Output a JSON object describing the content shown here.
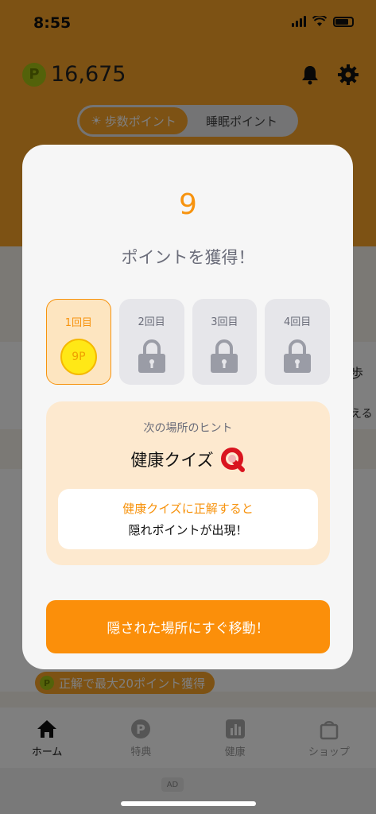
{
  "status_bar": {
    "time": "8:55"
  },
  "header": {
    "points": "16,675",
    "coin_letter": "P"
  },
  "segment": {
    "steps_label": "歩数ポイント",
    "sleep_label": "睡眠ポイント"
  },
  "background": {
    "badge_text": "正解で最大20ポイント獲得",
    "side_text_1": "歩",
    "side_text_2": "える"
  },
  "tabbar": {
    "items": [
      {
        "label": "ホーム",
        "icon": "home-icon"
      },
      {
        "label": "特典",
        "icon": "points-icon"
      },
      {
        "label": "健康",
        "icon": "chart-icon"
      },
      {
        "label": "ショップ",
        "icon": "shop-bag-icon"
      }
    ]
  },
  "ad": {
    "label": "AD"
  },
  "modal": {
    "points_earned": "9",
    "message": "ポイントを獲得！",
    "slots": [
      {
        "label": "1回目",
        "coin": "9P",
        "state": "unlocked"
      },
      {
        "label": "2回目",
        "state": "locked"
      },
      {
        "label": "3回目",
        "state": "locked"
      },
      {
        "label": "4回目",
        "state": "locked"
      }
    ],
    "hint": {
      "title": "次の場所のヒント",
      "place": "健康クイズ",
      "line1": "健康クイズに正解すると",
      "line2": "隠れポイントが出現！"
    },
    "button_label": "隠された場所にすぐ移動！"
  },
  "colors": {
    "orange": "#fb8f0a",
    "accent_text": "#f7930e",
    "coin_green": "#a7c415"
  }
}
